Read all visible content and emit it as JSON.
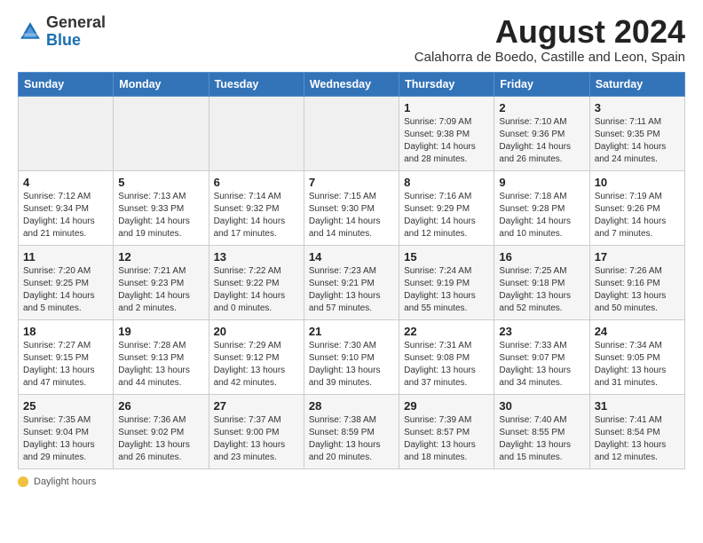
{
  "logo": {
    "general": "General",
    "blue": "Blue"
  },
  "title": "August 2024",
  "subtitle": "Calahorra de Boedo, Castille and Leon, Spain",
  "days_of_week": [
    "Sunday",
    "Monday",
    "Tuesday",
    "Wednesday",
    "Thursday",
    "Friday",
    "Saturday"
  ],
  "weeks": [
    [
      {
        "num": "",
        "info": ""
      },
      {
        "num": "",
        "info": ""
      },
      {
        "num": "",
        "info": ""
      },
      {
        "num": "",
        "info": ""
      },
      {
        "num": "1",
        "info": "Sunrise: 7:09 AM\nSunset: 9:38 PM\nDaylight: 14 hours and 28 minutes."
      },
      {
        "num": "2",
        "info": "Sunrise: 7:10 AM\nSunset: 9:36 PM\nDaylight: 14 hours and 26 minutes."
      },
      {
        "num": "3",
        "info": "Sunrise: 7:11 AM\nSunset: 9:35 PM\nDaylight: 14 hours and 24 minutes."
      }
    ],
    [
      {
        "num": "4",
        "info": "Sunrise: 7:12 AM\nSunset: 9:34 PM\nDaylight: 14 hours and 21 minutes."
      },
      {
        "num": "5",
        "info": "Sunrise: 7:13 AM\nSunset: 9:33 PM\nDaylight: 14 hours and 19 minutes."
      },
      {
        "num": "6",
        "info": "Sunrise: 7:14 AM\nSunset: 9:32 PM\nDaylight: 14 hours and 17 minutes."
      },
      {
        "num": "7",
        "info": "Sunrise: 7:15 AM\nSunset: 9:30 PM\nDaylight: 14 hours and 14 minutes."
      },
      {
        "num": "8",
        "info": "Sunrise: 7:16 AM\nSunset: 9:29 PM\nDaylight: 14 hours and 12 minutes."
      },
      {
        "num": "9",
        "info": "Sunrise: 7:18 AM\nSunset: 9:28 PM\nDaylight: 14 hours and 10 minutes."
      },
      {
        "num": "10",
        "info": "Sunrise: 7:19 AM\nSunset: 9:26 PM\nDaylight: 14 hours and 7 minutes."
      }
    ],
    [
      {
        "num": "11",
        "info": "Sunrise: 7:20 AM\nSunset: 9:25 PM\nDaylight: 14 hours and 5 minutes."
      },
      {
        "num": "12",
        "info": "Sunrise: 7:21 AM\nSunset: 9:23 PM\nDaylight: 14 hours and 2 minutes."
      },
      {
        "num": "13",
        "info": "Sunrise: 7:22 AM\nSunset: 9:22 PM\nDaylight: 14 hours and 0 minutes."
      },
      {
        "num": "14",
        "info": "Sunrise: 7:23 AM\nSunset: 9:21 PM\nDaylight: 13 hours and 57 minutes."
      },
      {
        "num": "15",
        "info": "Sunrise: 7:24 AM\nSunset: 9:19 PM\nDaylight: 13 hours and 55 minutes."
      },
      {
        "num": "16",
        "info": "Sunrise: 7:25 AM\nSunset: 9:18 PM\nDaylight: 13 hours and 52 minutes."
      },
      {
        "num": "17",
        "info": "Sunrise: 7:26 AM\nSunset: 9:16 PM\nDaylight: 13 hours and 50 minutes."
      }
    ],
    [
      {
        "num": "18",
        "info": "Sunrise: 7:27 AM\nSunset: 9:15 PM\nDaylight: 13 hours and 47 minutes."
      },
      {
        "num": "19",
        "info": "Sunrise: 7:28 AM\nSunset: 9:13 PM\nDaylight: 13 hours and 44 minutes."
      },
      {
        "num": "20",
        "info": "Sunrise: 7:29 AM\nSunset: 9:12 PM\nDaylight: 13 hours and 42 minutes."
      },
      {
        "num": "21",
        "info": "Sunrise: 7:30 AM\nSunset: 9:10 PM\nDaylight: 13 hours and 39 minutes."
      },
      {
        "num": "22",
        "info": "Sunrise: 7:31 AM\nSunset: 9:08 PM\nDaylight: 13 hours and 37 minutes."
      },
      {
        "num": "23",
        "info": "Sunrise: 7:33 AM\nSunset: 9:07 PM\nDaylight: 13 hours and 34 minutes."
      },
      {
        "num": "24",
        "info": "Sunrise: 7:34 AM\nSunset: 9:05 PM\nDaylight: 13 hours and 31 minutes."
      }
    ],
    [
      {
        "num": "25",
        "info": "Sunrise: 7:35 AM\nSunset: 9:04 PM\nDaylight: 13 hours and 29 minutes."
      },
      {
        "num": "26",
        "info": "Sunrise: 7:36 AM\nSunset: 9:02 PM\nDaylight: 13 hours and 26 minutes."
      },
      {
        "num": "27",
        "info": "Sunrise: 7:37 AM\nSunset: 9:00 PM\nDaylight: 13 hours and 23 minutes."
      },
      {
        "num": "28",
        "info": "Sunrise: 7:38 AM\nSunset: 8:59 PM\nDaylight: 13 hours and 20 minutes."
      },
      {
        "num": "29",
        "info": "Sunrise: 7:39 AM\nSunset: 8:57 PM\nDaylight: 13 hours and 18 minutes."
      },
      {
        "num": "30",
        "info": "Sunrise: 7:40 AM\nSunset: 8:55 PM\nDaylight: 13 hours and 15 minutes."
      },
      {
        "num": "31",
        "info": "Sunrise: 7:41 AM\nSunset: 8:54 PM\nDaylight: 13 hours and 12 minutes."
      }
    ]
  ],
  "footer": {
    "dot_label": "Daylight hours"
  }
}
